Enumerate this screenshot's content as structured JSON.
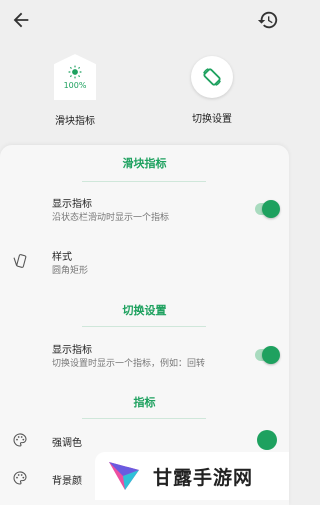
{
  "colors": {
    "accent": "#1ea15f",
    "background": "#efefef",
    "sheet": "#f7f7f7"
  },
  "topbar": {
    "back_icon": "arrow-left-icon",
    "history_icon": "history-icon"
  },
  "preview": {
    "slider": {
      "percent": "100%",
      "label": "滑块指标"
    },
    "switch": {
      "label": "切换设置"
    }
  },
  "sections": {
    "slider_indicator": "滑块指标",
    "switch_settings": "切换设置",
    "indicator": "指标"
  },
  "rows": {
    "slider_show": {
      "title": "显示指标",
      "subtitle": "沿状态栏滑动时显示一个指标",
      "toggle_on": true
    },
    "style": {
      "title": "样式",
      "subtitle": "圆角矩形"
    },
    "switch_show": {
      "title": "显示指标",
      "subtitle": "切换设置时显示一个指标，例如：回转",
      "toggle_on": true
    },
    "accent_color": {
      "title": "强调色",
      "color": "#1ea15f"
    },
    "background_color": {
      "title": "背景颜"
    }
  },
  "watermark": {
    "text": "甘露手游网"
  }
}
